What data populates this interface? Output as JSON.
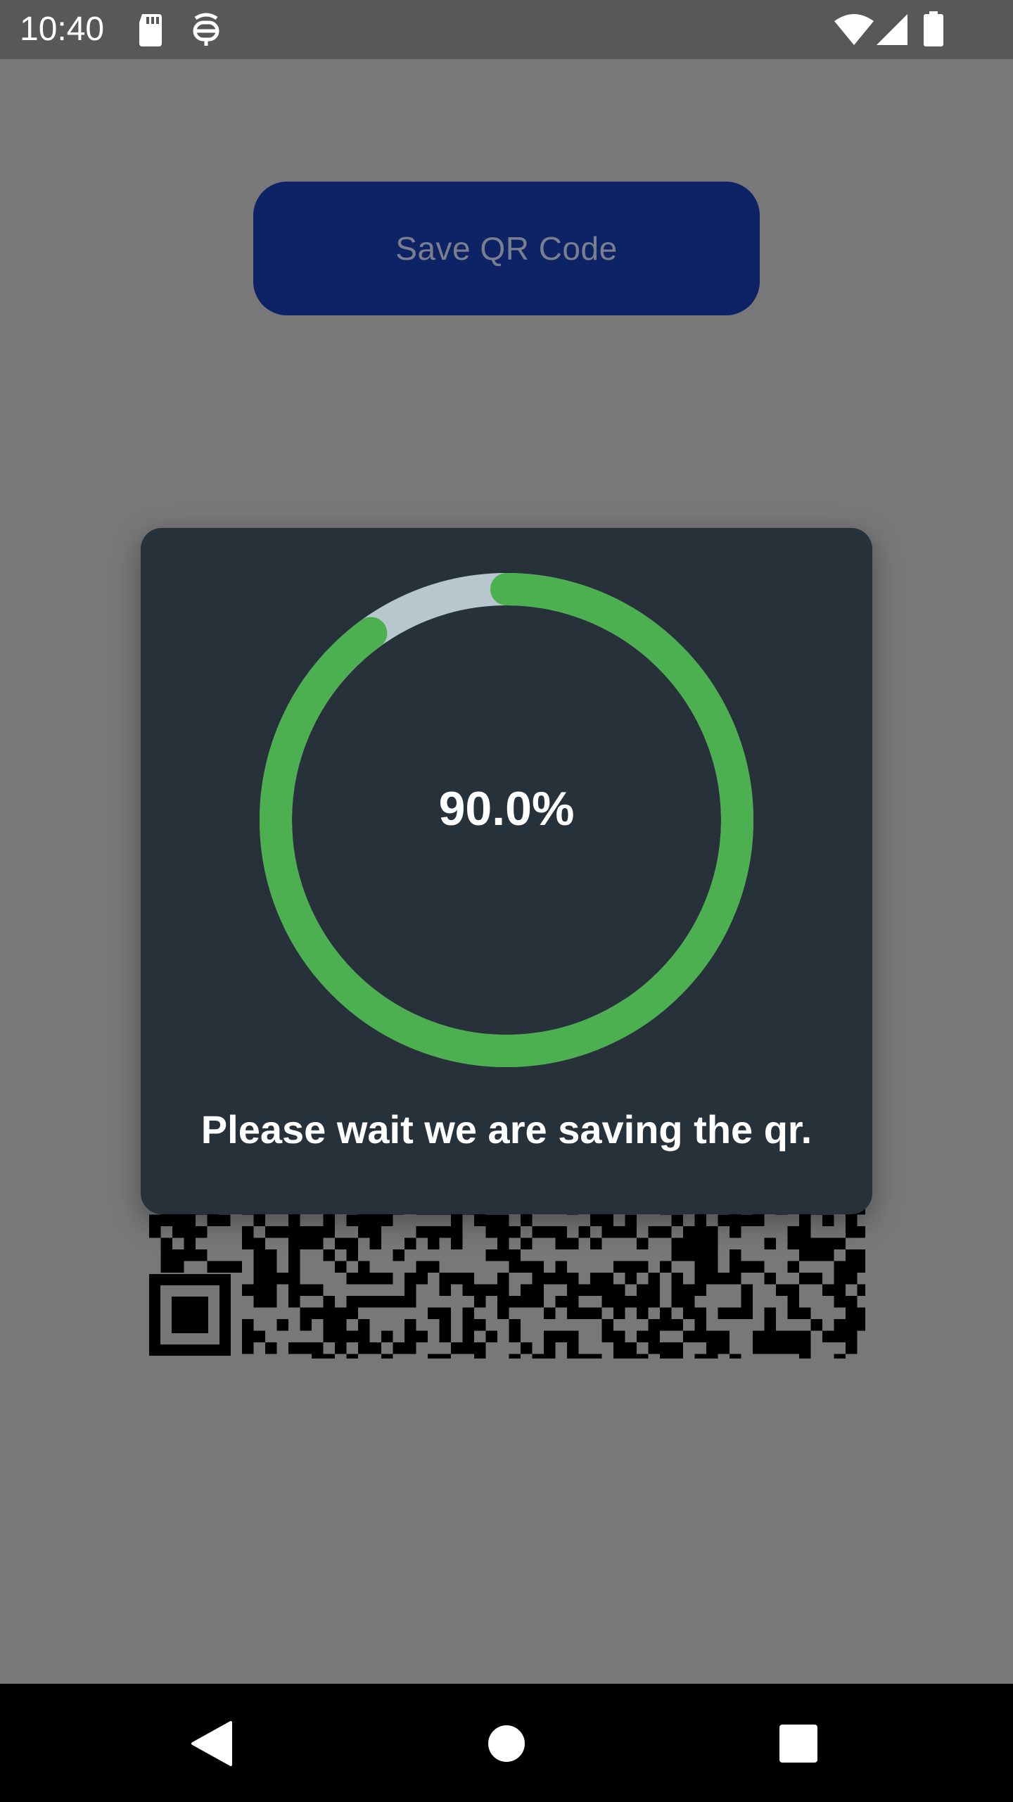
{
  "status_bar": {
    "time": "10:40",
    "icons": [
      "sd-card-icon",
      "debug-icon",
      "wifi-icon",
      "signal-icon",
      "battery-icon"
    ]
  },
  "main": {
    "save_button_label": "Save QR Code"
  },
  "dialog": {
    "progress_label": "90.0%",
    "progress_fraction": 0.9,
    "message": "Please wait we are saving the qr.",
    "colors": {
      "progress": "#4caf50",
      "track": "#b8c7cd",
      "background": "#27313a"
    }
  },
  "nav_bar": {
    "buttons": [
      "back-icon",
      "home-icon",
      "recents-icon"
    ]
  }
}
